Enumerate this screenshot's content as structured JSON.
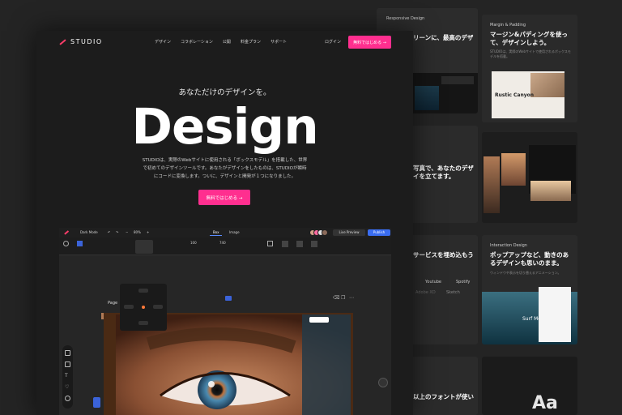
{
  "colors": {
    "accent": "#ff2f8f",
    "publish": "#3a6df0",
    "background": "#242424"
  },
  "bg_panels": {
    "responsive": {
      "tag": "Responsive Design",
      "title": "リーンに、最高のデザ"
    },
    "margin": {
      "tag": "Margin & Padding",
      "title": "マージン&パディングを使って、デザインしよう。",
      "card_title": "Rustic Canyon"
    },
    "photo": {
      "title": "写真で、あなたのデザイを立てます。"
    },
    "services": {
      "title": "サービスを埋め込もう",
      "items": [
        "Youtube",
        "Spotify",
        "Adobe XD",
        "Sketch"
      ]
    },
    "interaction": {
      "tag": "Interaction Design",
      "title": "ポップアップなど、動きのあるデザインも思いのまま。",
      "card_title": "Surf Me"
    },
    "fonts": {
      "title": "以上のフォントが使い",
      "glyph": "Aa"
    }
  },
  "nav": {
    "brand": "STUDIO",
    "links": [
      "デザイン",
      "コラボレーション",
      "公開",
      "料金プラン",
      "サポート"
    ],
    "login": "ログイン",
    "cta": "無料ではじめる →"
  },
  "hero": {
    "tagline": "あなただけのデザインを。",
    "title": "Design",
    "description_line1": "STUDIOは、実際のWebサイトに使用される「ボックスモデル」を搭載した、世界",
    "description_line2": "で初めてのデザインツールです。あなたがデザインをしたものは、STUDIOが瞬時",
    "description_line3": "にコードに変換します。ついに、デザインと開発が１つになりました。",
    "cta": "無料ではじめる →"
  },
  "editor": {
    "mode": "Dark Mode",
    "zoom": "80%",
    "tabs": [
      "Box",
      "Image"
    ],
    "live_preview": "Live Preview",
    "publish": "Publish",
    "props": [
      "100",
      "740"
    ],
    "page_label": "Page"
  }
}
